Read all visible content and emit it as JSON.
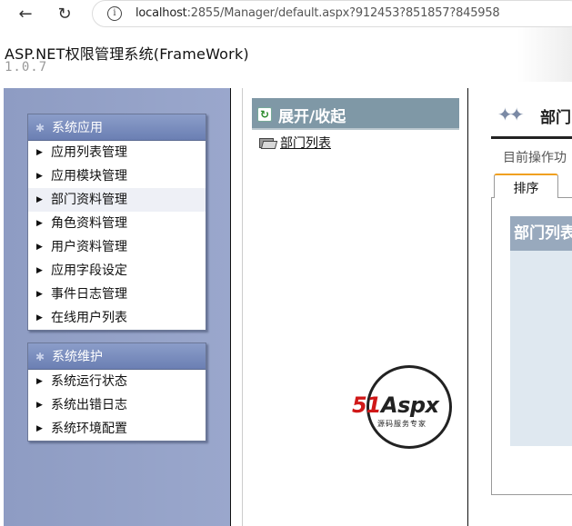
{
  "browser": {
    "url_host": "localhost",
    "url_rest": ":2855/Manager/default.aspx?912453?851857?845958"
  },
  "app": {
    "title": "ASP.NET权限管理系统(FrameWork)",
    "version": "1.0.7"
  },
  "sidebar": {
    "groups": [
      {
        "title": "系统应用",
        "items": [
          "应用列表管理",
          "应用模块管理",
          "部门资料管理",
          "角色资料管理",
          "用户资料管理",
          "应用字段设定",
          "事件日志管理",
          "在线用户列表"
        ]
      },
      {
        "title": "系统维护",
        "items": [
          "系统运行状态",
          "系统出错日志",
          "系统环境配置"
        ]
      }
    ],
    "active_item": "部门资料管理"
  },
  "middle": {
    "header": "展开/收起",
    "tree_item": "部门列表"
  },
  "logo": {
    "text_51": "51",
    "text_aspx": "Aspx",
    "subtitle": "源码服务专家"
  },
  "right": {
    "title": "部门",
    "operation": "目前操作功",
    "tab": "排序",
    "list_header": "部门列表"
  },
  "icons": {
    "back": "back-arrow-icon",
    "reload": "reload-icon",
    "info": "info-icon",
    "refresh": "refresh-icon",
    "folder": "folder-icon",
    "group_star": "star-icon",
    "bullet": "triangle-right-icon",
    "tools": "tools-icon"
  },
  "colors": {
    "sidebar_bg": "#8e9cc3",
    "box_head": "#6b7fb3",
    "mid_head": "#7f98a6",
    "tab_accent": "#f0a020",
    "logo_red": "#d01818",
    "logo_green": "#2ea82e"
  }
}
